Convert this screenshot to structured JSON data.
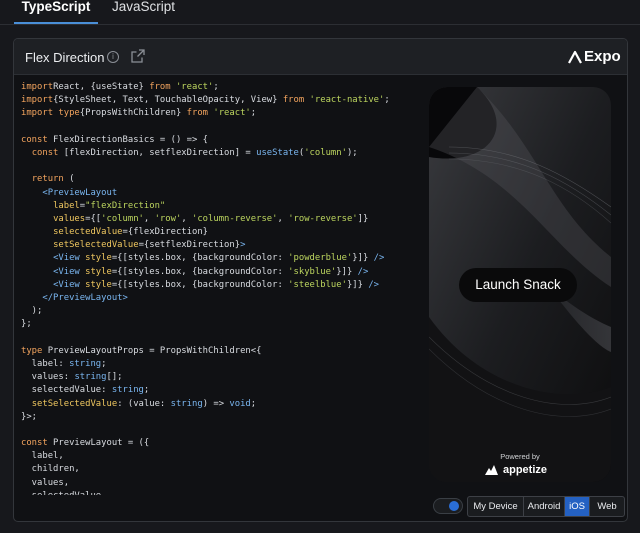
{
  "tabs": {
    "typescript": "TypeScript",
    "javascript": "JavaScript"
  },
  "header": {
    "title": "Flex Direction",
    "info_icon": "info-icon",
    "external_icon": "external-link-icon",
    "brand": "Expo"
  },
  "code_lines": [
    [
      [
        "kw",
        "import"
      ],
      [
        "",
        "React, {useState} "
      ],
      [
        "kw",
        "from"
      ],
      [
        "str",
        " 'react'"
      ],
      [
        "",
        ";"
      ]
    ],
    [
      [
        "kw",
        "import"
      ],
      [
        "",
        "{StyleSheet, Text, TouchableOpacity, View} "
      ],
      [
        "kw",
        "from"
      ],
      [
        "str",
        " 'react-native'"
      ],
      [
        "",
        ";"
      ]
    ],
    [
      [
        "kw",
        "import"
      ],
      [
        "kw",
        " type"
      ],
      [
        "",
        "{PropsWithChildren} "
      ],
      [
        "kw",
        "from"
      ],
      [
        "str",
        " 'react'"
      ],
      [
        "",
        ";"
      ]
    ],
    [],
    [
      [
        "kw",
        "const"
      ],
      [
        "",
        " FlexDirectionBasics = () => {"
      ]
    ],
    [
      [
        "",
        "  "
      ],
      [
        "kw",
        "const"
      ],
      [
        "",
        " [flexDirection, setflexDirection] = "
      ],
      [
        "tag",
        "useState"
      ],
      [
        "",
        "("
      ],
      [
        "str",
        "'column'"
      ],
      [
        "",
        ");"
      ]
    ],
    [],
    [
      [
        "",
        "  "
      ],
      [
        "kw",
        "return"
      ],
      [
        "",
        " ("
      ]
    ],
    [
      [
        "",
        "    "
      ],
      [
        "tag",
        "<PreviewLayout"
      ]
    ],
    [
      [
        "",
        "      "
      ],
      [
        "attr",
        "label"
      ],
      [
        "",
        "="
      ],
      [
        "str",
        "\"flexDirection\""
      ]
    ],
    [
      [
        "",
        "      "
      ],
      [
        "attr",
        "values"
      ],
      [
        "",
        "={["
      ],
      [
        "str",
        "'column'"
      ],
      [
        "",
        ", "
      ],
      [
        "str",
        "'row'"
      ],
      [
        "",
        ", "
      ],
      [
        "str",
        "'column-reverse'"
      ],
      [
        "",
        ", "
      ],
      [
        "str",
        "'row-reverse'"
      ],
      [
        "",
        "]}"
      ]
    ],
    [
      [
        "",
        "      "
      ],
      [
        "attr",
        "selectedValue"
      ],
      [
        "",
        "={flexDirection}"
      ]
    ],
    [
      [
        "",
        "      "
      ],
      [
        "attr",
        "setSelectedValue"
      ],
      [
        "",
        "={setflexDirection}"
      ],
      [
        "tag",
        ">"
      ]
    ],
    [
      [
        "",
        "      "
      ],
      [
        "tag",
        "<View"
      ],
      [
        "attr",
        " style"
      ],
      [
        "",
        "={[styles.box, {backgroundColor: "
      ],
      [
        "str",
        "'powderblue'"
      ],
      [
        "",
        "}]} "
      ],
      [
        "tag",
        "/>"
      ]
    ],
    [
      [
        "",
        "      "
      ],
      [
        "tag",
        "<View"
      ],
      [
        "attr",
        " style"
      ],
      [
        "",
        "={[styles.box, {backgroundColor: "
      ],
      [
        "str",
        "'skyblue'"
      ],
      [
        "",
        "}]} "
      ],
      [
        "tag",
        "/>"
      ]
    ],
    [
      [
        "",
        "      "
      ],
      [
        "tag",
        "<View"
      ],
      [
        "attr",
        " style"
      ],
      [
        "",
        "={[styles.box, {backgroundColor: "
      ],
      [
        "str",
        "'steelblue'"
      ],
      [
        "",
        "}]} "
      ],
      [
        "tag",
        "/>"
      ]
    ],
    [
      [
        "",
        "    "
      ],
      [
        "tag",
        "</PreviewLayout>"
      ]
    ],
    [
      [
        "",
        "  );"
      ]
    ],
    [
      [
        "",
        "};"
      ]
    ],
    [],
    [
      [
        "kw",
        "type"
      ],
      [
        "",
        " PreviewLayoutProps = PropsWithChildren<{"
      ]
    ],
    [
      [
        "",
        "  label: "
      ],
      [
        "tag",
        "string"
      ],
      [
        "",
        ";"
      ]
    ],
    [
      [
        "",
        "  values: "
      ],
      [
        "tag",
        "string"
      ],
      [
        "",
        "[];"
      ]
    ],
    [
      [
        "",
        "  selectedValue: "
      ],
      [
        "tag",
        "string"
      ],
      [
        "",
        ";"
      ]
    ],
    [
      [
        "",
        "  "
      ],
      [
        "attr",
        "setSelectedValue"
      ],
      [
        "",
        ": (value: "
      ],
      [
        "tag",
        "string"
      ],
      [
        "",
        ") => "
      ],
      [
        "tag",
        "void"
      ],
      [
        "",
        ";"
      ]
    ],
    [
      [
        "",
        "}>;"
      ]
    ],
    [],
    [
      [
        "kw",
        "const"
      ],
      [
        "",
        " PreviewLayout = ({"
      ]
    ],
    [
      [
        "",
        "  label,"
      ]
    ],
    [
      [
        "",
        "  children,"
      ]
    ],
    [
      [
        "",
        "  values,"
      ]
    ],
    [
      [
        "",
        "  selectedValue,"
      ]
    ]
  ],
  "preview": {
    "launch_label": "Launch Snack",
    "powered_by": "Powered by",
    "appetize": "appetize"
  },
  "device_bar": {
    "toggle_on": true,
    "options": [
      "My Device",
      "Android",
      "iOS",
      "Web"
    ],
    "selected": "iOS"
  },
  "colors": {
    "accent": "#2461c2",
    "tab_underline": "#4a8fd8",
    "keyword": "#f3a45e",
    "string": "#bdd65f",
    "tag": "#7ab6f0",
    "attribute": "#f0c860"
  }
}
